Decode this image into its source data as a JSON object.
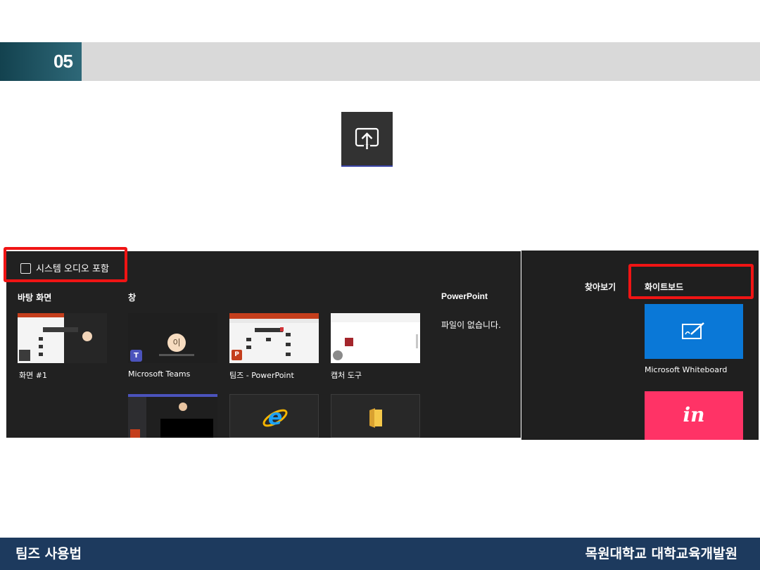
{
  "header": {
    "number": "05"
  },
  "share_panel": {
    "system_audio_label": "시스템 오디오 포함",
    "sections": {
      "desktop": "바탕 화면",
      "window": "창",
      "powerpoint": "PowerPoint"
    },
    "desktop_items": [
      {
        "caption": "화면 #1"
      }
    ],
    "window_items": [
      {
        "caption": "Microsoft Teams",
        "icon": "teams-icon"
      },
      {
        "caption": "팀즈 - PowerPoint",
        "icon": "powerpoint-icon"
      },
      {
        "caption": "캡처 도구",
        "icon": "snipping-tool-icon"
      }
    ],
    "window_items_row2": [
      {
        "caption": "",
        "icon": "teams-meeting-icon"
      },
      {
        "caption": "",
        "icon": "internet-explorer-icon"
      },
      {
        "caption": "",
        "icon": "file-explorer-icon"
      }
    ],
    "powerpoint_empty": "파일이 없습니다.",
    "avatar_initial": "이"
  },
  "whiteboard_panel": {
    "browse_tab": "찾아보기",
    "whiteboard_tab": "화이트보드",
    "items": [
      {
        "caption": "Microsoft Whiteboard",
        "color": "#0a78d7",
        "icon": "whiteboard-pen-icon"
      },
      {
        "caption": "",
        "color": "#ff3366",
        "icon": "invision-icon",
        "logo_text": "in"
      }
    ]
  },
  "footer": {
    "left": "팀즈 사용법",
    "right": "목원대학교 대학교육개발원"
  },
  "colors": {
    "highlight": "#f01414",
    "footer_bg": "#1d3a5e",
    "header_band": "#d9d9d9",
    "header_accent": "#1f5563"
  }
}
